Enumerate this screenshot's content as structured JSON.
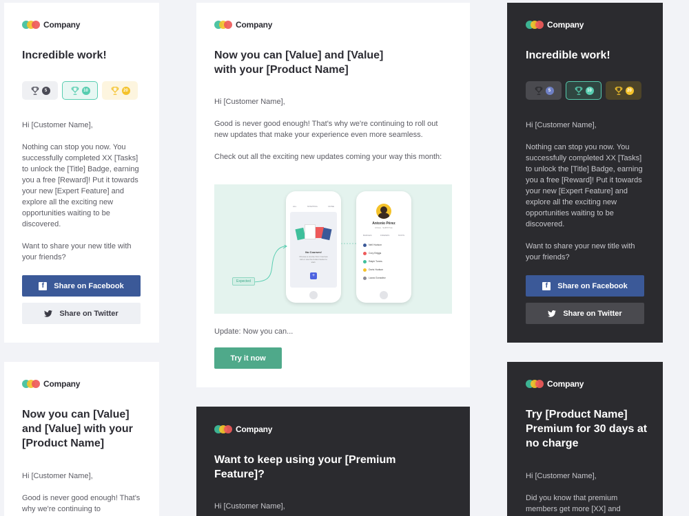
{
  "brand": {
    "name": "Company"
  },
  "achievement": {
    "title": "Incredible work!",
    "badges": [
      "5",
      "10",
      "20"
    ],
    "greeting": "Hi [Customer Name],",
    "paragraph": "Nothing can stop you now. You successfully completed XX [Tasks] to unlock the [Title] Badge, earning you a free [Reward]! Put it towards your new [Expert Feature] and explore all the exciting new opportunities waiting to be discovered.",
    "share_prompt": "Want to share your new title with your friends?",
    "facebook_label": "Share on Facebook",
    "twitter_label": "Share on Twitter"
  },
  "update_email": {
    "title_line1": "Now you can [Value] and [Value]",
    "title_line2": "with your [Product Name]",
    "greeting": "Hi [Customer Name],",
    "paragraph1": "Good is never good enough! That's why we're continuing to roll out new updates that make your experience even more seamless.",
    "paragraph2": "Check out all the exciting new updates coming your way this month:",
    "update_line": "Update: Now you can...",
    "cta": "Try it now",
    "illustration": {
      "tabs": [
        "ALL",
        "STARTING",
        "DONE"
      ],
      "empty_title": "No Courses!",
      "empty_text": "Choose a course from Courses tab or use the button below to start.",
      "plus": "+",
      "expected_label": "Expected",
      "profile_name": "Antonio Pérez",
      "profile_sub": "ROLE · SUBTITLE",
      "profile_tabs": [
        "BADGES",
        "FRIENDS",
        "STATS"
      ],
      "friends": [
        "Nell Hudson",
        "Cory Briggs",
        "Ralph Torres",
        "Doris Hudson",
        "Laura Gonzalez"
      ]
    }
  },
  "update_small": {
    "title": "Now you can [Value] and [Value] with your [Product Name]",
    "greeting": "Hi [Customer Name],",
    "paragraph": "Good is never good enough! That's why we're continuing to"
  },
  "premium_keep": {
    "title": "Want to keep using your [Premium Feature]?",
    "greeting": "Hi [Customer Name],"
  },
  "premium_trial": {
    "title": "Try [Product Name] Premium for 30 days at no charge",
    "greeting": "Hi [Customer Name],",
    "paragraph": "Did you know that premium members get more [XX] and"
  },
  "colors": {
    "background": "#f2f3f7",
    "dark_card": "#2b2b2f",
    "facebook": "#3b5998",
    "accent_green": "#4fa98a",
    "teal": "#57cdb0",
    "gold": "#f4c22b"
  }
}
